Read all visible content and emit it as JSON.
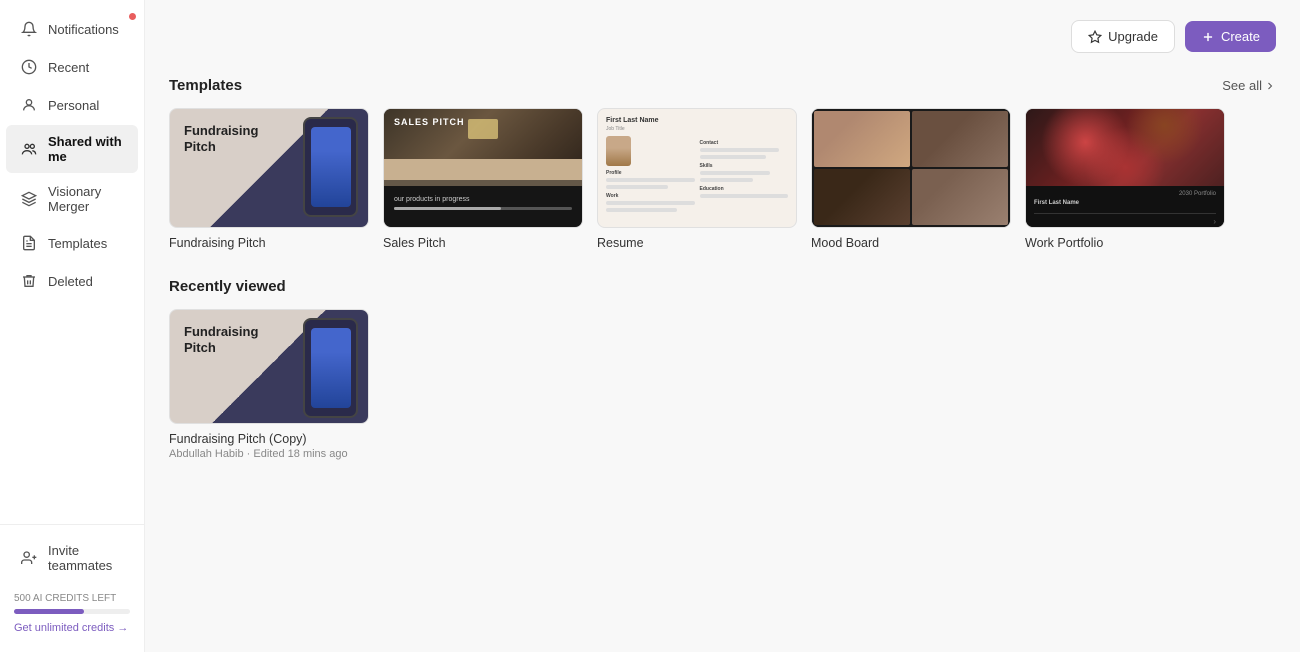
{
  "sidebar": {
    "items": [
      {
        "id": "notifications",
        "label": "Notifications",
        "icon": "bell"
      },
      {
        "id": "recent",
        "label": "Recent",
        "icon": "clock"
      },
      {
        "id": "personal",
        "label": "Personal",
        "icon": "person-circle"
      },
      {
        "id": "shared",
        "label": "Shared with me",
        "icon": "people",
        "active": true
      },
      {
        "id": "visionary",
        "label": "Visionary Merger",
        "icon": "layers"
      },
      {
        "id": "templates",
        "label": "Templates",
        "icon": "file-text"
      },
      {
        "id": "deleted",
        "label": "Deleted",
        "icon": "trash"
      }
    ],
    "bottom_item": {
      "id": "invite",
      "label": "Invite teammates",
      "icon": "person-plus"
    },
    "credits": {
      "text": "500 AI CREDITS LEFT",
      "get_label": "Get unlimited credits →",
      "fill_percent": 60
    }
  },
  "topbar": {
    "upgrade_label": "Upgrade",
    "create_label": "Create"
  },
  "templates_section": {
    "title": "Templates",
    "see_all_label": "See all",
    "cards": [
      {
        "id": "fundraising-pitch",
        "label": "Fundraising Pitch"
      },
      {
        "id": "sales-pitch",
        "label": "Sales Pitch"
      },
      {
        "id": "resume",
        "label": "Resume"
      },
      {
        "id": "mood-board",
        "label": "Mood Board"
      },
      {
        "id": "work-portfolio",
        "label": "Work Portfolio"
      }
    ]
  },
  "recently_section": {
    "title": "Recently viewed",
    "cards": [
      {
        "id": "fundraising-pitch-copy",
        "label": "Fundraising Pitch (Copy)",
        "author": "Abdullah Habib",
        "edited": "Edited 18 mins ago"
      }
    ]
  }
}
